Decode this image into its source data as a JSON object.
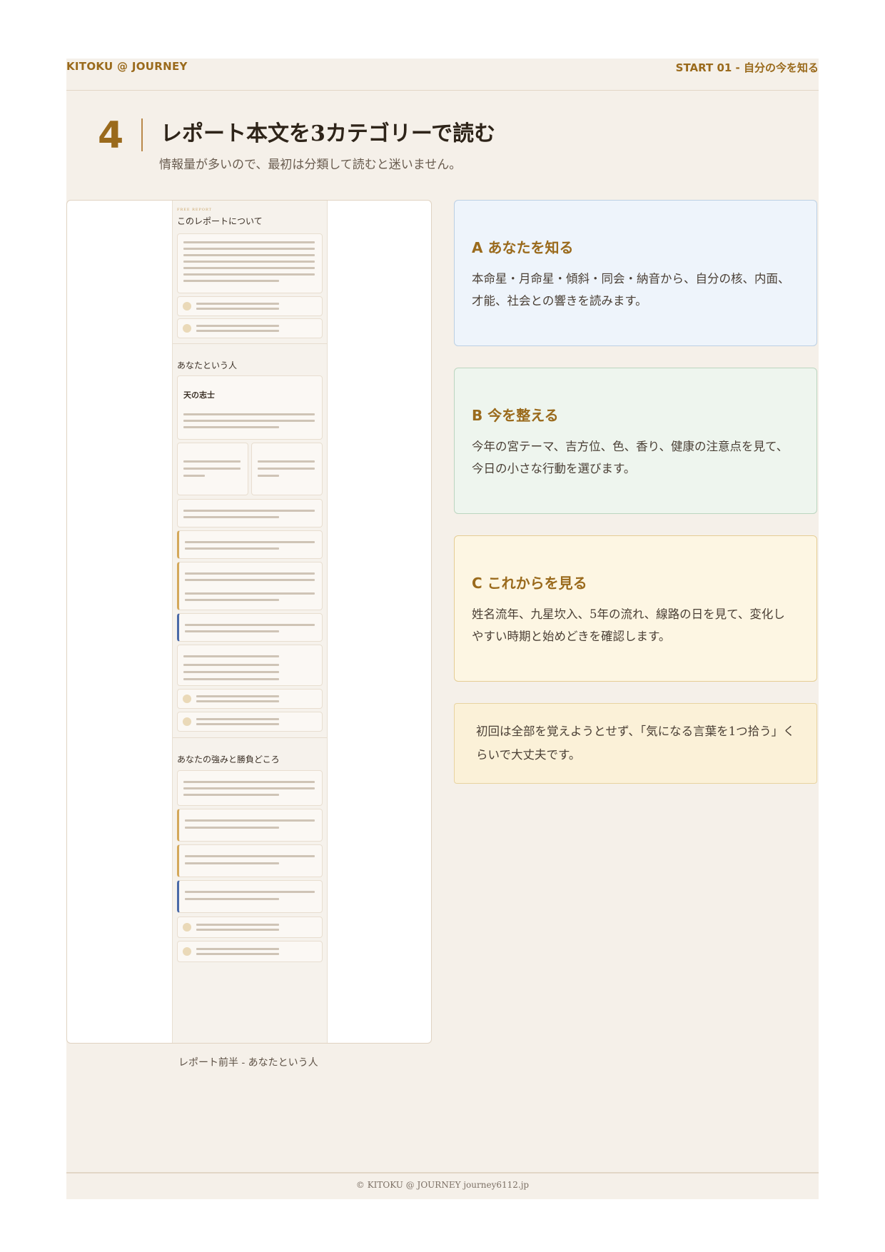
{
  "header": {
    "left": "KITOKU @ JOURNEY",
    "right": "START 01 - 自分の今を知る"
  },
  "section": {
    "number": "4",
    "title": "レポート本文を3カテゴリーで読む",
    "subtitle": "情報量が多いので、最初は分類して読むと迷いません。"
  },
  "screenshot": {
    "tag": "FREE REPORT",
    "h1": "このレポートについて",
    "h2": "あなたという人",
    "card_title": "天の志士",
    "h3": "あなたの強みと勝負どころ",
    "caption": "レポート前半 - あなたという人"
  },
  "cards": [
    {
      "heading": "A あなたを知る",
      "text": "本命星・月命星・傾斜・同会・納音から、自分の核、内面、才能、社会との響きを読みます。",
      "color": "#eef4fb"
    },
    {
      "heading": "B 今を整える",
      "text": "今年の宮テーマ、吉方位、色、香り、健康の注意点を見て、今日の小さな行動を選びます。",
      "color": "#eef5ee"
    },
    {
      "heading": "C これからを見る",
      "text": "姓名流年、九星坎入、5年の流れ、線路の日を見て、変化しやすい時期と始めどきを確認します。",
      "color": "#fdf6e3"
    }
  ],
  "note": {
    "text": "初回は全部を覚えようとせず、「気になる言葉を1つ拾う」くらいで大丈夫です。"
  },
  "footer": {
    "text": "© KITOKU @ JOURNEY journey6112.jp"
  },
  "accent_color": "#9a6a1c"
}
